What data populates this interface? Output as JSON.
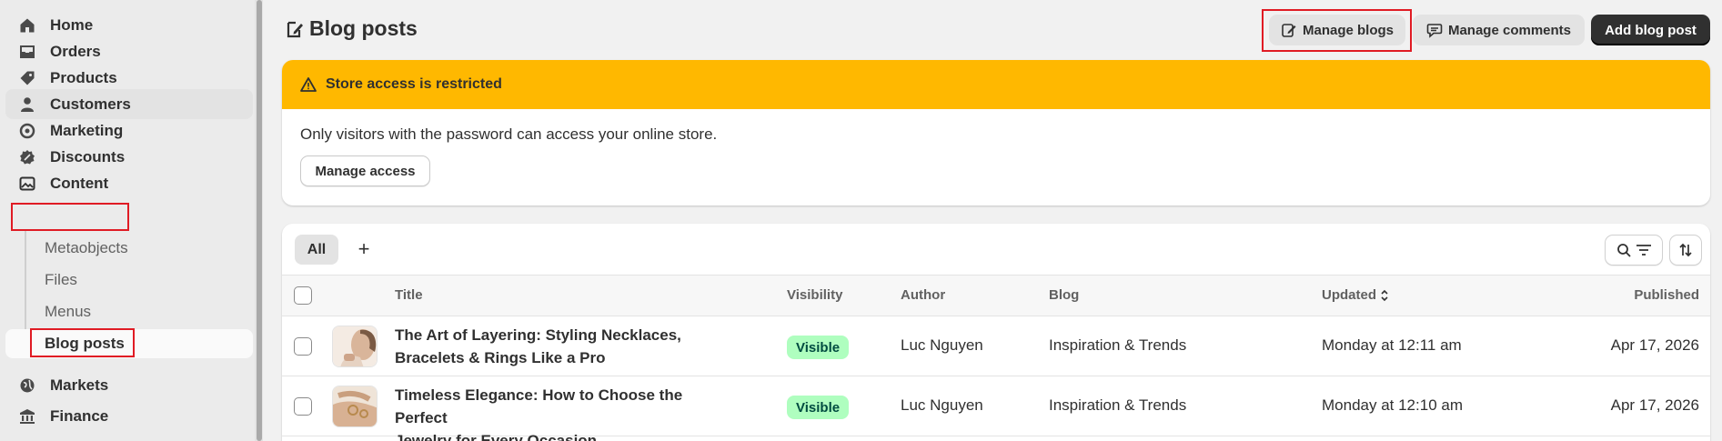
{
  "sidebar": {
    "items": [
      {
        "label": "Home",
        "icon": "home-icon"
      },
      {
        "label": "Orders",
        "icon": "inbox-icon"
      },
      {
        "label": "Products",
        "icon": "tag-icon"
      },
      {
        "label": "Customers",
        "icon": "person-icon"
      },
      {
        "label": "Marketing",
        "icon": "target-icon"
      },
      {
        "label": "Discounts",
        "icon": "discount-icon"
      },
      {
        "label": "Content",
        "icon": "image-icon"
      }
    ],
    "content_subitems": [
      "Metaobjects",
      "Files",
      "Menus",
      "Blog posts"
    ],
    "bottom_items": [
      {
        "label": "Markets",
        "icon": "globe-icon"
      },
      {
        "label": "Finance",
        "icon": "bank-icon"
      }
    ]
  },
  "header": {
    "title": "Blog posts",
    "manage_blogs": "Manage blogs",
    "manage_comments": "Manage comments",
    "add_blog_post": "Add blog post"
  },
  "banner": {
    "title": "Store access is restricted",
    "text": "Only visitors with the password can access your online store.",
    "button": "Manage access"
  },
  "table": {
    "tabs": [
      "All"
    ],
    "add_tab": "+",
    "columns": {
      "title": "Title",
      "visibility": "Visibility",
      "author": "Author",
      "blog": "Blog",
      "updated": "Updated",
      "published": "Published"
    },
    "rows": [
      {
        "title_line1": "The Art of Layering: Styling Necklaces,",
        "title_line2": "Bracelets & Rings Like a Pro",
        "visibility": "Visible",
        "author": "Luc Nguyen",
        "blog": "Inspiration & Trends",
        "updated": "Monday at 12:11 am",
        "published": "Apr 17, 2026"
      },
      {
        "title_line1": "Timeless Elegance: How to Choose the Perfect",
        "title_line2": "Jewelry for Every Occasion",
        "visibility": "Visible",
        "author": "Luc Nguyen",
        "blog": "Inspiration & Trends",
        "updated": "Monday at 12:10 am",
        "published": "Apr 17, 2026"
      }
    ]
  },
  "colors": {
    "warning_banner": "#ffb800",
    "badge_bg": "#affebf",
    "badge_text": "#014b40",
    "primary_button": "#303030",
    "highlight_box": "#e01b24"
  }
}
